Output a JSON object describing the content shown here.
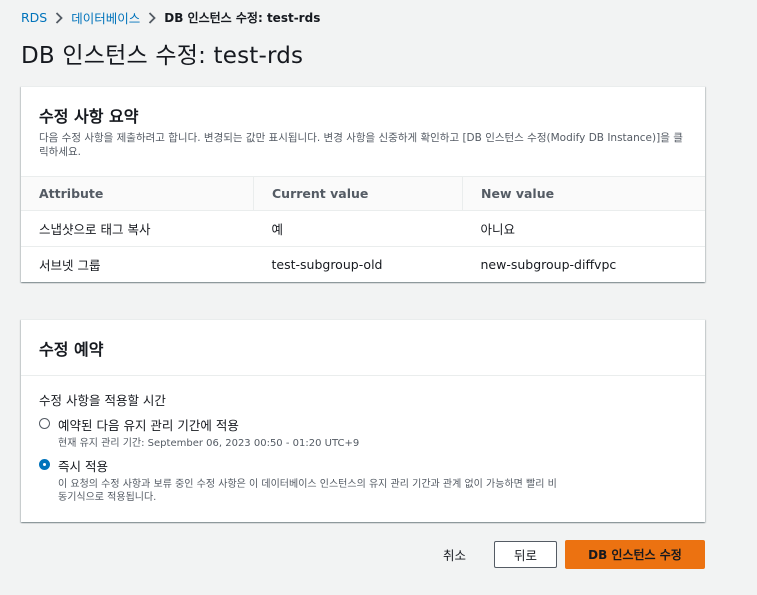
{
  "breadcrumb": {
    "root": "RDS",
    "section": "데이터베이스",
    "current": "DB 인스턴스 수정: test-rds"
  },
  "page": {
    "title": "DB 인스턴스 수정: test-rds"
  },
  "summary": {
    "title": "수정 사항 요약",
    "description": "다음 수정 사항을 제출하려고 합니다. 변경되는 값만 표시됩니다. 변경 사항을 신중하게 확인하고 [DB 인스턴스 수정(Modify DB Instance)]을 클릭하세요.",
    "columns": [
      "Attribute",
      "Current value",
      "New value"
    ],
    "rows": [
      [
        "스냅샷으로 태그 복사",
        "예",
        "아니요"
      ],
      [
        "서브넷 그룹",
        "test-subgroup-old",
        "new-subgroup-diffvpc"
      ]
    ]
  },
  "schedule": {
    "title": "수정 예약",
    "label": "수정 사항을 적용할 시간",
    "options": [
      {
        "label": "예약된 다음 유지 관리 기간에 적용",
        "description": "현재 유지 관리 기간: September 06, 2023 00:50 - 01:20 UTC+9",
        "selected": false
      },
      {
        "label": "즉시 적용",
        "description": "이 요청의 수정 사항과 보류 중인 수정 사항은 이 데이터베이스 인스턴스의 유지 관리 기간과 관계 없이 가능하면 빨리 비동기식으로 적용됩니다.",
        "selected": true
      }
    ]
  },
  "actions": {
    "cancel": "취소",
    "back": "뒤로",
    "submit": "DB 인스턴스 수정"
  },
  "colors": {
    "link": "#0073bb",
    "primary": "#ec7211",
    "radio_selected": "#0073bb",
    "background": "#f2f3f3"
  }
}
